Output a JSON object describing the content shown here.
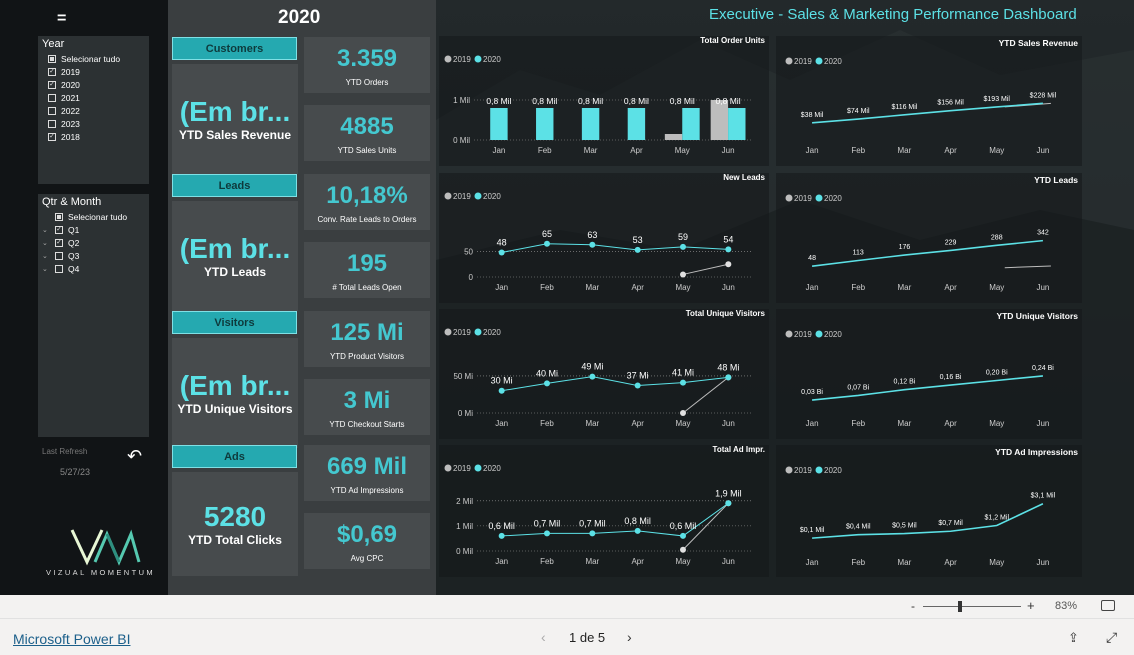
{
  "header": {
    "year_title": "2020",
    "page_title": "Executive - Sales & Marketing Performance Dashboard",
    "menu_icon": "hamburger-icon"
  },
  "slicers": {
    "year": {
      "title": "Year",
      "items": [
        {
          "label": "Selecionar tudo",
          "state": "partial"
        },
        {
          "label": "2019",
          "state": "checked"
        },
        {
          "label": "2020",
          "state": "checked"
        },
        {
          "label": "2021",
          "state": "unchecked"
        },
        {
          "label": "2022",
          "state": "unchecked"
        },
        {
          "label": "2023",
          "state": "unchecked"
        },
        {
          "label": "2018",
          "state": "checked"
        }
      ]
    },
    "qtr_month": {
      "title": "Qtr & Month",
      "items": [
        {
          "label": "Selecionar tudo",
          "state": "partial",
          "expand": false
        },
        {
          "label": "Q1",
          "state": "checked",
          "expand": true
        },
        {
          "label": "Q2",
          "state": "checked",
          "expand": true
        },
        {
          "label": "Q3",
          "state": "unchecked",
          "expand": true
        },
        {
          "label": "Q4",
          "state": "unchecked",
          "expand": true
        }
      ]
    }
  },
  "refresh": {
    "label": "Last Refresh",
    "date": "5/27/23"
  },
  "logo": {
    "text": "VIZUAL MOMENTUM"
  },
  "categories": [
    {
      "tag": "Customers",
      "big_value": "(Em br...",
      "big_label": "YTD Sales Revenue",
      "kpis": [
        {
          "value": "3.359",
          "label": "YTD Orders"
        },
        {
          "value": "4885",
          "label": "YTD Sales Units"
        }
      ]
    },
    {
      "tag": "Leads",
      "big_value": "(Em br...",
      "big_label": "YTD Leads",
      "kpis": [
        {
          "value": "10,18%",
          "label": "Conv. Rate Leads to Orders"
        },
        {
          "value": "195",
          "label": "# Total Leads Open"
        }
      ]
    },
    {
      "tag": "Visitors",
      "big_value": "(Em br...",
      "big_label": "YTD Unique Visitors",
      "kpis": [
        {
          "value": "125 Mi",
          "label": "YTD Product Visitors"
        },
        {
          "value": "3 Mi",
          "label": "YTD Checkout Starts"
        }
      ]
    },
    {
      "tag": "Ads",
      "big_value": "5280",
      "big_label": "YTD Total Clicks",
      "kpis": [
        {
          "value": "669 Mil",
          "label": "YTD Ad Impressions"
        },
        {
          "value": "$0,69",
          "label": "Avg CPC"
        }
      ]
    }
  ],
  "colors": {
    "accent": "#5ce1e6",
    "series_2019": "#bdbdbd",
    "series_2020": "#5ce1e6",
    "tag_bg": "#25a9b0"
  },
  "chart_data": [
    {
      "type": "bar",
      "title": "Total Order Units",
      "legend": [
        "2019",
        "2020"
      ],
      "legend_position": "top-left",
      "categories": [
        "Jan",
        "Feb",
        "Mar",
        "Apr",
        "May",
        "Jun"
      ],
      "series": [
        {
          "name": "2019",
          "values": [
            null,
            null,
            null,
            null,
            150,
            1000
          ]
        },
        {
          "name": "2020",
          "values": [
            800,
            800,
            800,
            800,
            800,
            800
          ]
        }
      ],
      "data_labels": [
        "0,8 Mil",
        "0,8 Mil",
        "0,8 Mil",
        "0,8 Mil",
        "0,8 Mil",
        "0,8 Mil"
      ],
      "yticks": [
        {
          "v": 0,
          "l": "0 Mil"
        },
        {
          "v": 1000,
          "l": "1 Mil"
        }
      ],
      "ylim": [
        0,
        1100
      ]
    },
    {
      "type": "line",
      "title": "YTD Sales Revenue",
      "legend": [
        "2019",
        "2020"
      ],
      "legend_position": "top-left",
      "categories": [
        "Jan",
        "Feb",
        "Mar",
        "Apr",
        "May",
        "Jun"
      ],
      "series": [
        {
          "name": "2019",
          "values": [
            null,
            null,
            null,
            null,
            193,
            228
          ]
        },
        {
          "name": "2020",
          "values": [
            38,
            74,
            116,
            156,
            193,
            228
          ]
        }
      ],
      "data_labels": [
        "$38 Mil",
        "$74 Mil",
        "$116 Mil",
        "$156 Mil",
        "$193 Mil",
        "$228 Mil"
      ],
      "yticks": [],
      "ylim": [
        -150,
        300
      ]
    },
    {
      "type": "line",
      "title": "New Leads",
      "legend": [
        "2019",
        "2020"
      ],
      "legend_position": "top-left",
      "categories": [
        "Jan",
        "Feb",
        "Mar",
        "Apr",
        "May",
        "Jun"
      ],
      "series": [
        {
          "name": "2019",
          "values": [
            null,
            null,
            null,
            null,
            5,
            25
          ]
        },
        {
          "name": "2020",
          "values": [
            48,
            65,
            63,
            53,
            59,
            54
          ]
        }
      ],
      "data_labels": [
        "48",
        "65",
        "63",
        "53",
        "59",
        "54"
      ],
      "yticks": [
        {
          "v": 0,
          "l": "0"
        },
        {
          "v": 50,
          "l": "50"
        }
      ],
      "ylim": [
        0,
        90
      ]
    },
    {
      "type": "line",
      "title": "YTD Leads",
      "legend": [
        "2019",
        "2020"
      ],
      "legend_position": "top-left",
      "categories": [
        "Jan",
        "Feb",
        "Mar",
        "Apr",
        "May",
        "Jun"
      ],
      "series": [
        {
          "name": "2019",
          "values": [
            null,
            null,
            null,
            null,
            30,
            50
          ]
        },
        {
          "name": "2020",
          "values": [
            48,
            113,
            176,
            229,
            288,
            342
          ]
        }
      ],
      "data_labels": [
        "48",
        "113",
        "176",
        "229",
        "288",
        "342"
      ],
      "yticks": [],
      "ylim": [
        -100,
        430
      ]
    },
    {
      "type": "line",
      "title": "Total Unique Visitors",
      "legend": [
        "2019",
        "2020"
      ],
      "legend_position": "top-left",
      "categories": [
        "Jan",
        "Feb",
        "Mar",
        "Apr",
        "May",
        "Jun"
      ],
      "series": [
        {
          "name": "2019",
          "values": [
            null,
            null,
            null,
            null,
            0,
            48
          ]
        },
        {
          "name": "2020",
          "values": [
            30,
            40,
            49,
            37,
            41,
            48
          ]
        }
      ],
      "data_labels": [
        "30 Mi",
        "40 Mi",
        "49 Mi",
        "37 Mi",
        "41 Mi",
        "48 Mi"
      ],
      "yticks": [
        {
          "v": 0,
          "l": "0 Mi"
        },
        {
          "v": 50,
          "l": "50 Mi"
        }
      ],
      "ylim": [
        0,
        62
      ]
    },
    {
      "type": "line",
      "title": "YTD Unique Visitors",
      "legend": [
        "2019",
        "2020"
      ],
      "legend_position": "top-left",
      "categories": [
        "Jan",
        "Feb",
        "Mar",
        "Apr",
        "May",
        "Jun"
      ],
      "series": [
        {
          "name": "2020",
          "values": [
            0.03,
            0.07,
            0.12,
            0.16,
            0.2,
            0.24
          ]
        }
      ],
      "data_labels": [
        "0,03 Bi",
        "0,07 Bi",
        "0,12 Bi",
        "0,16 Bi",
        "0,20 Bi",
        "0,24 Bi"
      ],
      "yticks": [],
      "ylim": [
        -0.1,
        0.3
      ]
    },
    {
      "type": "line",
      "title": "Total Ad Impr.",
      "legend": [
        "2019",
        "2020"
      ],
      "legend_position": "top-left",
      "categories": [
        "Jan",
        "Feb",
        "Mar",
        "Apr",
        "May",
        "Jun"
      ],
      "series": [
        {
          "name": "2019",
          "values": [
            null,
            null,
            null,
            null,
            0.05,
            1.9
          ]
        },
        {
          "name": "2020",
          "values": [
            0.6,
            0.7,
            0.7,
            0.8,
            0.6,
            1.9
          ]
        }
      ],
      "data_labels": [
        "0,6 Mil",
        "0,7 Mil",
        "0,7 Mil",
        "0,8 Mil",
        "0,6 Mil",
        "1,9 Mil"
      ],
      "yticks": [
        {
          "v": 0,
          "l": "0 Mil"
        },
        {
          "v": 1,
          "l": "1 Mil"
        },
        {
          "v": 2,
          "l": "2 Mil"
        }
      ],
      "ylim": [
        0,
        2.15
      ]
    },
    {
      "type": "line",
      "title": "YTD Ad Impressions",
      "legend": [
        "2019",
        "2020"
      ],
      "legend_position": "top-left",
      "categories": [
        "Jan",
        "Feb",
        "Mar",
        "Apr",
        "May",
        "Jun"
      ],
      "series": [
        {
          "name": "2020",
          "values": [
            0.1,
            0.4,
            0.5,
            0.7,
            1.2,
            3.1
          ]
        }
      ],
      "data_labels": [
        "$0,1 Mil",
        "$0,4 Mil",
        "$0,5 Mil",
        "$0,7 Mil",
        "$1,2 Mil",
        "$3,1 Mil"
      ],
      "yticks": [],
      "ylim": [
        -0.5,
        3.6
      ]
    }
  ],
  "statusbar": {
    "zoom_minus": "-",
    "zoom_plus": "+",
    "zoom_value": "83%",
    "zoom_level": 0.38
  },
  "footer": {
    "link": "Microsoft Power BI",
    "page_indicator": "1 de 5",
    "prev": "‹",
    "next": "›"
  }
}
